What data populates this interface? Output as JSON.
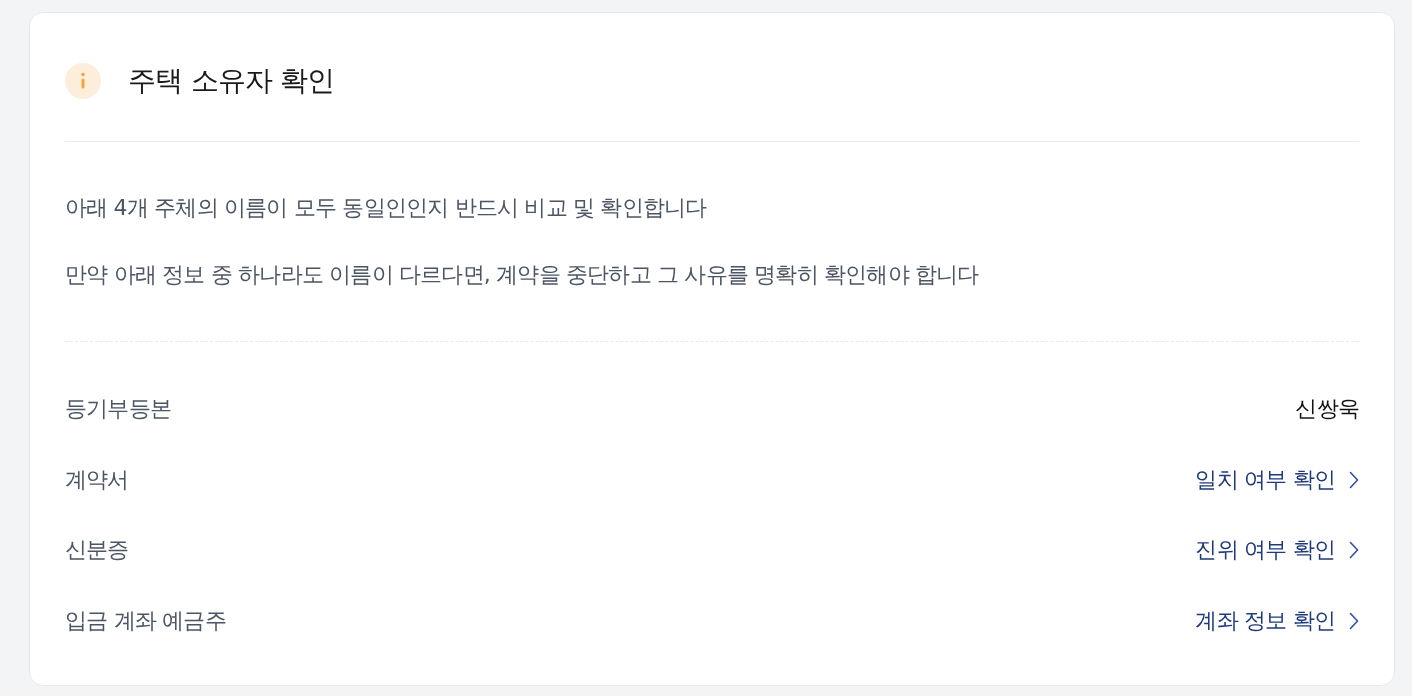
{
  "header": {
    "title": "주택 소유자 확인"
  },
  "notices": [
    "아래 4개 주체의 이름이 모두 동일인인지 반드시 비교 및 확인합니다",
    "만약 아래 정보 중 하나라도 이름이 다르다면, 계약을 중단하고 그 사유를 명확히 확인해야 합니다"
  ],
  "rows": [
    {
      "label": "등기부등본",
      "kind": "value",
      "value": "신쌍욱"
    },
    {
      "label": "계약서",
      "kind": "link",
      "value": "일치 여부 확인"
    },
    {
      "label": "신분증",
      "kind": "link",
      "value": "진위 여부 확인"
    },
    {
      "label": "입금 계좌 예금주",
      "kind": "link",
      "value": "계좌 정보 확인"
    }
  ]
}
